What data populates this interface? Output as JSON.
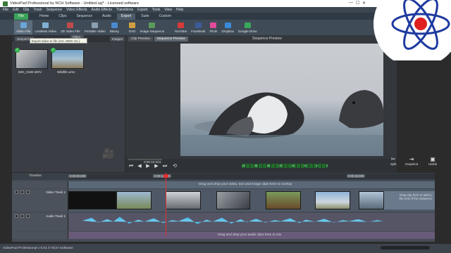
{
  "window": {
    "title": "VideoPad Professional by NCH Software - Untitled.vpj* - Licensed software"
  },
  "menu": [
    "File",
    "Edit",
    "Clip",
    "Track",
    "Sequence",
    "Video Effects",
    "Audio Effects",
    "Transitions",
    "Export",
    "Tools",
    "View",
    "Help"
  ],
  "ribbon_tabs": [
    "File",
    "Home",
    "Clips",
    "Sequence",
    "Audio",
    "Export",
    "Suite",
    "Custom"
  ],
  "ribbon_active": "Export",
  "toolbar": [
    {
      "label": "Video File",
      "icon": "film-icon",
      "color": "#6aa6d8"
    },
    {
      "label": "Lossless Video",
      "icon": "lossless-icon",
      "color": "#7fb0d0"
    },
    {
      "label": "3D Video File",
      "icon": "3d-icon",
      "color": "#c04a4a"
    },
    {
      "label": "Portable Video",
      "icon": "phone-icon",
      "color": "#8aa0b0"
    },
    {
      "label": "Bluray",
      "icon": "disc-icon",
      "color": "#4a8ad0"
    },
    {
      "label": "DVD",
      "icon": "dvd-icon",
      "color": "#d0a040"
    },
    {
      "label": "Image Sequence",
      "icon": "images-icon",
      "color": "#5a9a5a"
    },
    {
      "label": "YouTube",
      "icon": "youtube-icon",
      "color": "#d83a3a"
    },
    {
      "label": "Facebook",
      "icon": "facebook-icon",
      "color": "#3b5b9a"
    },
    {
      "label": "Flickr",
      "icon": "flickr-icon",
      "color": "#e04a9a"
    },
    {
      "label": "Dropbox",
      "icon": "dropbox-icon",
      "color": "#3a8ad8"
    },
    {
      "label": "Google Drive",
      "icon": "gdrive-icon",
      "color": "#3aa85a"
    }
  ],
  "tooltip": "Export video to file (AVI, WMV etc.)",
  "media_tabs": [
    "Sequence",
    "Video Files",
    "Images"
  ],
  "media": [
    {
      "name": "IMG_0180.MOV"
    },
    {
      "name": "Wildlife.wmv"
    }
  ],
  "preview": {
    "tabs": [
      "Clip Preview",
      "Sequence Preview"
    ],
    "title": "Sequence Preview",
    "timecode": "0:00:10.023",
    "vu_labels": [
      "-42",
      "-36",
      "-30",
      "-24",
      "-18",
      "-12",
      "-6",
      "0"
    ]
  },
  "actions": [
    {
      "label": "Split"
    },
    {
      "label": "Snapshot"
    },
    {
      "label": "Unlink"
    }
  ],
  "timeline": {
    "label": "Timeline",
    "ticks": [
      "0:00:00.000",
      "0:00:10.000",
      "0:00:20.000"
    ],
    "video_track": "Video Track 1",
    "audio_track": "Audio Track 1",
    "overlay_drop": "Drag and drop your video, text and image clips here to overlay",
    "end_drop": "Drag clip here to add to the end of the sequence",
    "audio_drop": "Drag and drop your audio clips here to mix"
  },
  "status": "VideoPad Professional v 6.01 © NCH Software"
}
